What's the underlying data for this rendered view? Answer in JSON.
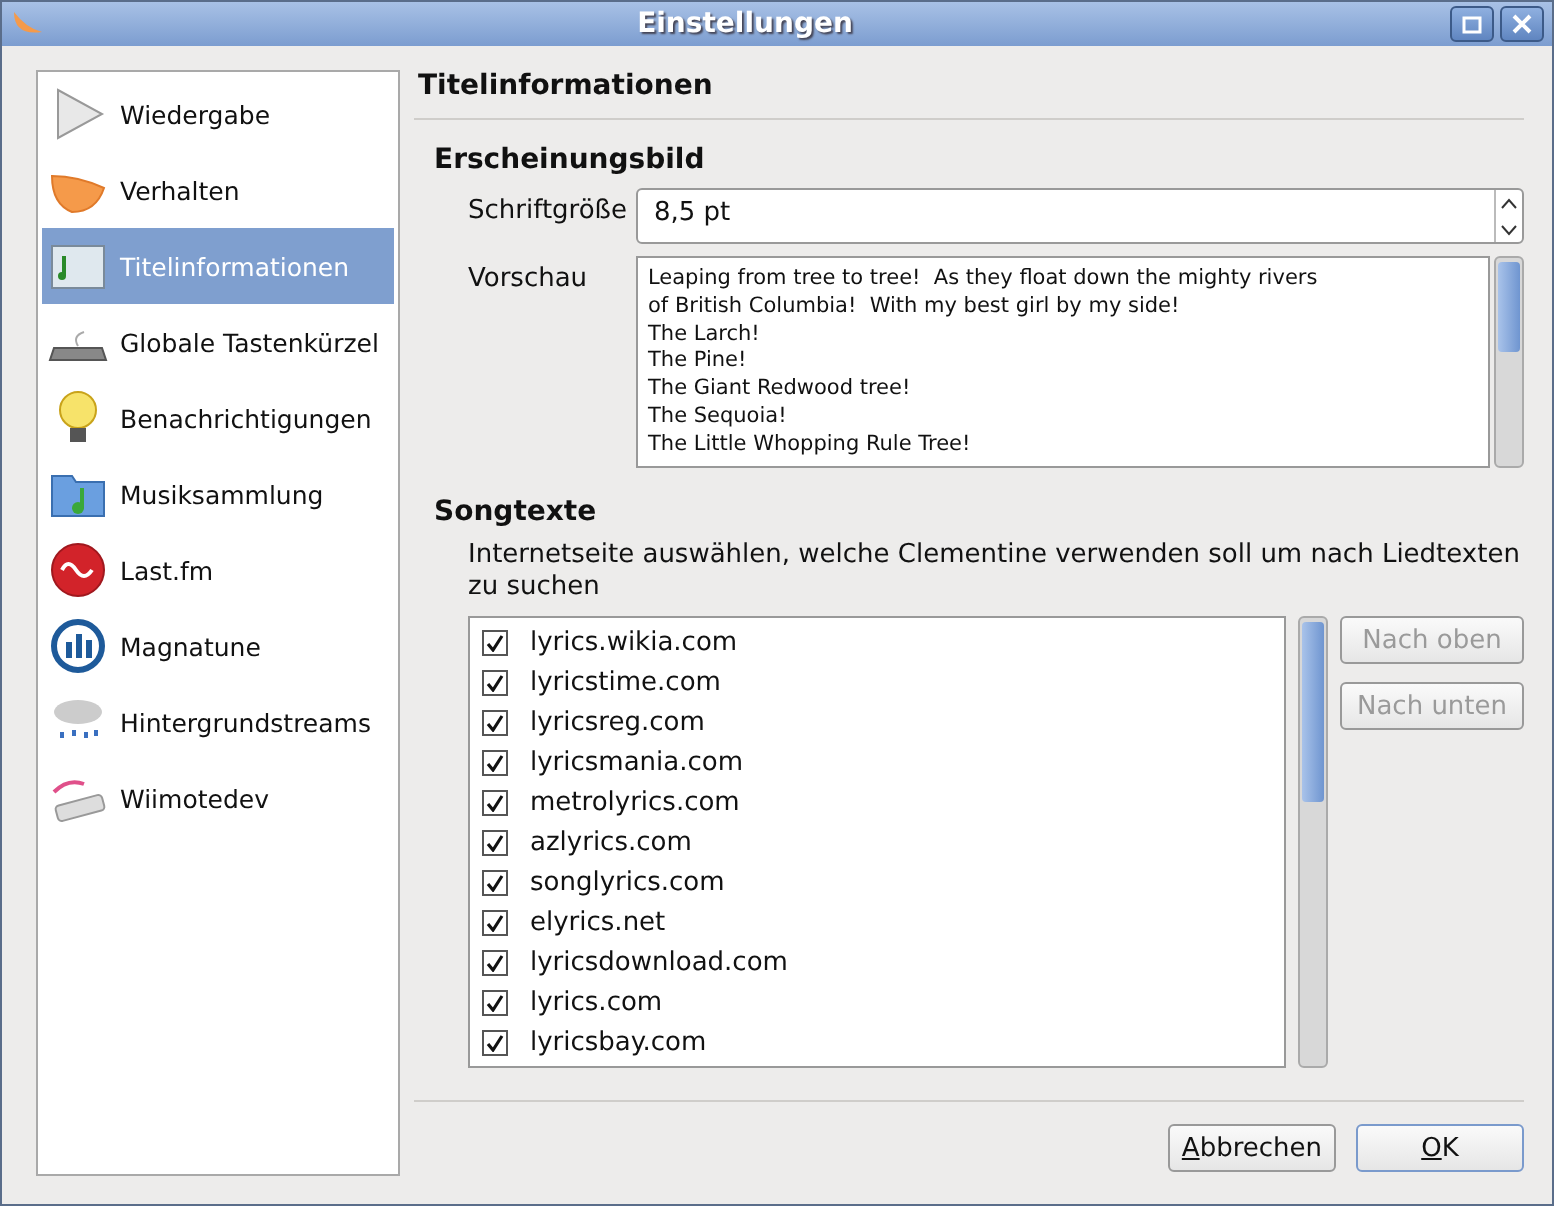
{
  "window": {
    "title": "Einstellungen"
  },
  "sidebar": {
    "items": [
      {
        "label": "Wiedergabe",
        "kind": "play",
        "selected": false
      },
      {
        "label": "Verhalten",
        "kind": "fruit",
        "selected": false
      },
      {
        "label": "Titelinformationen",
        "kind": "window",
        "selected": true
      },
      {
        "label": "Globale Tastenkürzel",
        "kind": "keyboard",
        "selected": false
      },
      {
        "label": "Benachrichtigungen",
        "kind": "bulb",
        "selected": false
      },
      {
        "label": "Musiksammlung",
        "kind": "folder",
        "selected": false
      },
      {
        "label": "Last.fm",
        "kind": "lastfm",
        "selected": false
      },
      {
        "label": "Magnatune",
        "kind": "bars",
        "selected": false
      },
      {
        "label": "Hintergrundstreams",
        "kind": "rain",
        "selected": false
      },
      {
        "label": "Wiimotedev",
        "kind": "remote",
        "selected": false
      }
    ]
  },
  "page_title": "Titelinformationen",
  "appearance": {
    "heading": "Erscheinungsbild",
    "font_size_label": "Schriftgröße",
    "font_size": "8,5 pt",
    "preview_label": "Vorschau",
    "preview_lines": [
      "Leaping from tree to tree!  As they float down the mighty rivers",
      "of British Columbia!  With my best girl by my side!",
      "The Larch!",
      "The Pine!",
      "The Giant Redwood tree!",
      "The Sequoia!",
      "The Little Whopping Rule Tree!"
    ]
  },
  "lyrics": {
    "heading": "Songtexte",
    "description": "Internetseite auswählen, welche Clementine verwenden soll um nach Liedtexten zu suchen",
    "providers": [
      {
        "label": "lyrics.wikia.com",
        "checked": true
      },
      {
        "label": "lyricstime.com",
        "checked": true
      },
      {
        "label": "lyricsreg.com",
        "checked": true
      },
      {
        "label": "lyricsmania.com",
        "checked": true
      },
      {
        "label": "metrolyrics.com",
        "checked": true
      },
      {
        "label": "azlyrics.com",
        "checked": true
      },
      {
        "label": "songlyrics.com",
        "checked": true
      },
      {
        "label": "elyrics.net",
        "checked": true
      },
      {
        "label": "lyricsdownload.com",
        "checked": true
      },
      {
        "label": "lyrics.com",
        "checked": true
      },
      {
        "label": "lyricsbay.com",
        "checked": true
      }
    ],
    "buttons": [
      {
        "label": "Nach oben",
        "disabled": true
      },
      {
        "label": "Nach unten",
        "disabled": true
      }
    ]
  },
  "buttons": [
    {
      "label": "Abbrechen",
      "default": false
    },
    {
      "label": "OK",
      "default": true
    }
  ]
}
